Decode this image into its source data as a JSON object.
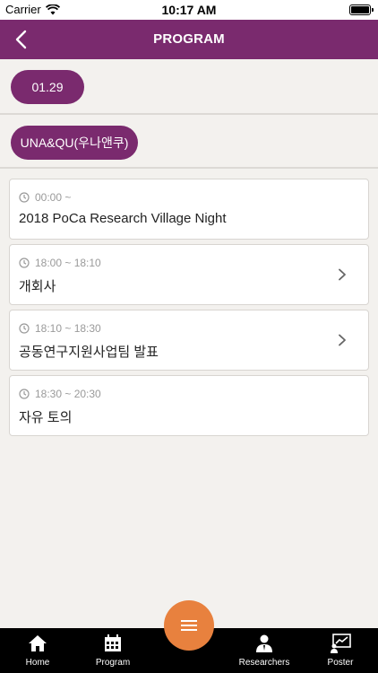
{
  "status_bar": {
    "carrier": "Carrier",
    "time": "10:17 AM"
  },
  "header": {
    "title": "PROGRAM"
  },
  "date_selector": {
    "selected": "01.29"
  },
  "team_selector": {
    "selected": "UNA&QU(우나앤쿠)"
  },
  "program_items": [
    {
      "time": "00:00 ~",
      "title": "2018 PoCa Research Village Night",
      "has_detail": false
    },
    {
      "time": "18:00 ~ 18:10",
      "title": "개회사",
      "has_detail": true
    },
    {
      "time": "18:10 ~ 18:30",
      "title": "공동연구지원사업팀 발표",
      "has_detail": true
    },
    {
      "time": "18:30 ~ 20:30",
      "title": "자유 토의",
      "has_detail": false
    }
  ],
  "tab_bar": {
    "tabs": [
      {
        "label": "Home",
        "icon": "home-icon"
      },
      {
        "label": "Program",
        "icon": "calendar-icon"
      },
      {
        "label": "Researchers",
        "icon": "researcher-icon"
      },
      {
        "label": "Poster",
        "icon": "poster-icon"
      }
    ],
    "center_button_icon": "menu-icon"
  },
  "colors": {
    "primary": "#7a2a6e",
    "accent": "#e8813e",
    "background": "#f3f1ee"
  }
}
